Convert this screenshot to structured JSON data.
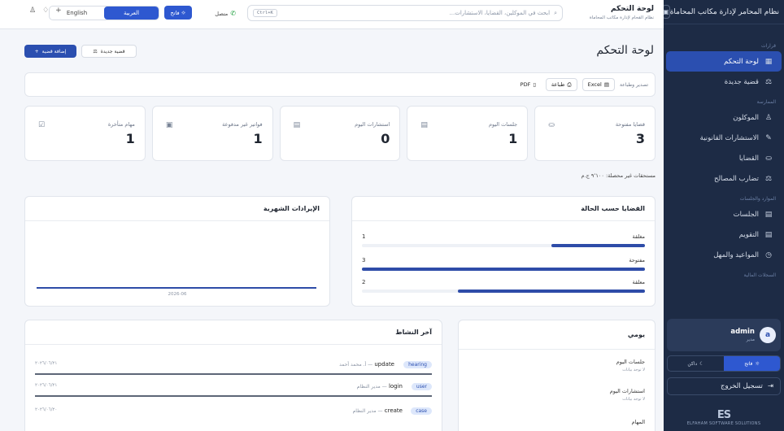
{
  "sidebar": {
    "title": "نظام المحامر لإدارة مكاتب المحاماة",
    "toggle_icon": "▣",
    "sections": [
      "قرارات",
      "الممارسة",
      "الموارد والجلسات",
      "السجلات المالية"
    ],
    "items": [
      {
        "label": "لوحة التحكم",
        "icon": "▦",
        "active": true
      },
      {
        "label": "قضية جديدة",
        "icon": "⚖"
      },
      {
        "label": "الموكلون",
        "icon": "♙"
      },
      {
        "label": "الاستشارات القانونية",
        "icon": "✎"
      },
      {
        "label": "القضايا",
        "icon": "⛀"
      },
      {
        "label": "تضارب المصالح",
        "icon": "⚖"
      },
      {
        "label": "الجلسات",
        "icon": "▤"
      },
      {
        "label": "التقويم",
        "icon": "▤"
      },
      {
        "label": "المواعيد والمهل",
        "icon": "◷"
      }
    ],
    "user": {
      "name": "admin",
      "role": "مدير",
      "initial": "a"
    },
    "theme": {
      "light": "فاتح",
      "dark": "داكن"
    },
    "logout": "تسجيل الخروج",
    "brand": {
      "logo": "ES",
      "text": "ELFAHAM SOFTWARE SOLUTIONS"
    }
  },
  "topbar": {
    "title": "لوحة التحكم",
    "subtitle": "نظام القحام لإدارة مكاتب المحاماة",
    "search_placeholder": "ابحث في الموكلين، القضايا، الاستشارات...",
    "shortcut": "Ctrl+K",
    "connection": "متصل",
    "light_label": "فاتح",
    "lang_arabic": "العربية",
    "lang_english": "English"
  },
  "page": {
    "title": "لوحة التحكم",
    "add_case": "إضافة قضية",
    "new_case": "قضية جديدة"
  },
  "export": {
    "label": "تصدير وطباعة",
    "excel": "Excel",
    "print": "طباعة",
    "pdf": "PDF"
  },
  "stats": [
    {
      "label": "قضايا مفتوحة",
      "value": "3",
      "icon": "⛀"
    },
    {
      "label": "جلسات اليوم",
      "value": "1",
      "icon": "▤"
    },
    {
      "label": "استشارات اليوم",
      "value": "0",
      "icon": "▤"
    },
    {
      "label": "فواتير غير مدفوعة",
      "value": "1",
      "icon": "▣"
    },
    {
      "label": "مهام متأخرة",
      "value": "1",
      "icon": "☑"
    }
  ],
  "due_text": "مستحقات غير محصلة: ٩٬١٠٠ ج.م",
  "status_card": {
    "title": "القضايا حسب الحالة",
    "rows": [
      {
        "label": "مغلقة",
        "count": "1",
        "fraction": 0.33
      },
      {
        "label": "مفتوحة",
        "count": "3",
        "fraction": 1.0
      },
      {
        "label": "معلقة",
        "count": "2",
        "fraction": 0.66
      }
    ]
  },
  "revenue_card": {
    "title": "الإيرادات الشهرية",
    "x_label": "2026-06"
  },
  "activity_card": {
    "title": "آخر النشاط",
    "rows": [
      {
        "tag": "hearing",
        "action": "update",
        "who": "أ. محمد أحمد",
        "date": "٢٠٢٦/٠٦/٢١"
      },
      {
        "tag": "user",
        "action": "login",
        "who": "مدير النظام",
        "date": "٢٠٢٦/٠٦/٢١"
      },
      {
        "tag": "case",
        "action": "create",
        "who": "مدير النظام",
        "date": "٢٠٢٦/٠٦/٢٠"
      }
    ]
  },
  "daily_card": {
    "title": "يومي",
    "sections": [
      {
        "title": "جلسات اليوم",
        "empty": "لا توجد بيانات"
      },
      {
        "title": "استشارات اليوم",
        "empty": "لا توجد بيانات"
      },
      {
        "title": "المهام",
        "empty": ""
      }
    ]
  }
}
